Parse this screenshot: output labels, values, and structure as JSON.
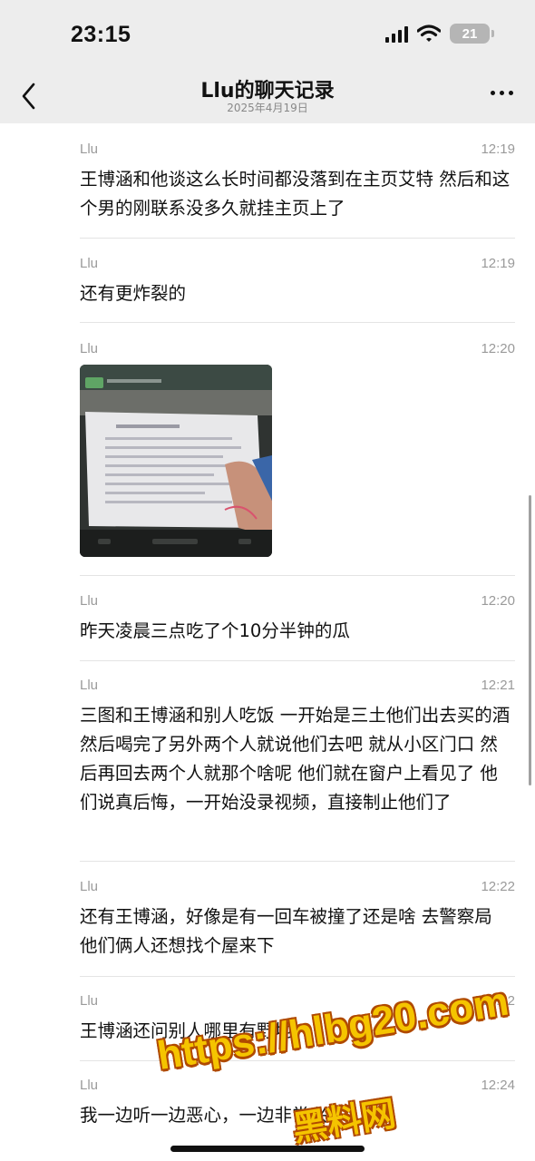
{
  "status_bar": {
    "time": "23:15",
    "battery": "21"
  },
  "nav": {
    "title": "Llu的聊天记录",
    "subtitle": "2025年4月19日"
  },
  "messages": [
    {
      "sender": "Llu",
      "time": "12:19",
      "text": "王博涵和他谈这么长时间都没落到在主页艾特 然后和这个男的刚联系没多久就挂主页上了"
    },
    {
      "sender": "Llu",
      "time": "12:19",
      "text": "还有更炸裂的"
    },
    {
      "sender": "Llu",
      "time": "12:20",
      "image": "document-photo-thumbnail"
    },
    {
      "sender": "Llu",
      "time": "12:20",
      "text": "昨天凌晨三点吃了个10分半钟的瓜"
    },
    {
      "sender": "Llu",
      "time": "12:21",
      "text": "三图和王博涵和别人吃饭 一开始是三土他们出去买的酒 然后喝完了另外两个人就说他们去吧 就从小区门口 然后再回去两个人就那个啥呢 他们就在窗户上看见了 他们说真后悔，一开始没录视频，直接制止他们了"
    },
    {
      "sender": "Llu",
      "time": "12:22",
      "text": "还有王博涵，好像是有一回车被撞了还是啥 去警察局 他们俩人还想找个屋来下"
    },
    {
      "sender": "Llu",
      "time": "12:22",
      "text": "王博涵还问别人哪里有野地"
    },
    {
      "sender": "Llu",
      "time": "12:24",
      "text": "我一边听一边恶心，一边非常兴奋"
    }
  ],
  "watermark": {
    "url": "https://hlbg20.com",
    "name": "黑料网"
  }
}
